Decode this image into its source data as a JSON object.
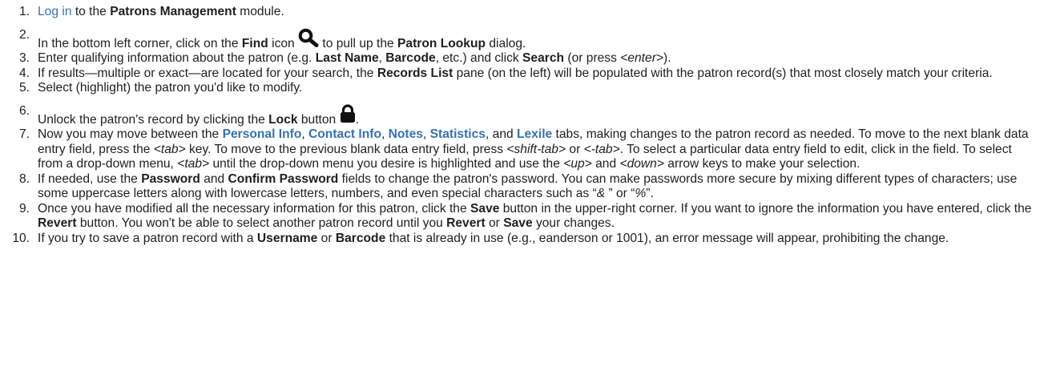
{
  "steps": [
    {
      "num": "1.",
      "a": "Log in",
      "b": " to the ",
      "c": "Patrons Management",
      "d": " module."
    },
    {
      "num": "2.",
      "a": "In the bottom left corner, click on the ",
      "b": "Find",
      "c": " icon ",
      "d": " to pull up the ",
      "e": "Patron Lookup",
      "f": " dialog.",
      "icon": "search-icon"
    },
    {
      "num": "3.",
      "a": "Enter qualifying information about the patron (e.g. ",
      "b": "Last Name",
      "c": ", ",
      "d": "Barcode",
      "e": ", etc.) and click ",
      "f": "Search",
      "g": " (or press ",
      "h": "<enter>",
      "i": ")."
    },
    {
      "num": "4.",
      "a": "If results—multiple or exact—are located for your search, the ",
      "b": "Records List",
      "c": " pane (on the left) will be populated with the patron record(s) that most closely match your criteria."
    },
    {
      "num": "5.",
      "a": "Select (highlight) the patron you'd like to modify."
    },
    {
      "num": "6.",
      "a": "Unlock the patron's record by clicking the ",
      "b": "Lock",
      "c": " button ",
      "d": ".",
      "icon": "lock-icon"
    },
    {
      "num": "7.",
      "a": "Now you may move between the ",
      "b": "Personal Info",
      "c": ", ",
      "d": "Contact Info",
      "e": ", ",
      "f": "Notes",
      "g": ", ",
      "h": "Statistics",
      "i": ", and ",
      "j": "Lexile",
      "k": " tabs, making changes to the patron record as needed. To move to the next blank data entry field, press the ",
      "l": "<tab>",
      "m": " key. To move to the previous blank data entry field, press ",
      "n": "<shift-tab>",
      "o": " or ",
      "p": "<-tab>",
      "q": ". To select a particular data entry field to edit, click in the field. To select from a drop-down menu, ",
      "r": "<tab>",
      "s": " until the drop-down menu you desire is highlighted and use the ",
      "t": "<up>",
      "u": " and ",
      "v": "<down>",
      "w": " arrow keys to make your selection."
    },
    {
      "num": "8.",
      "a": "If needed, use the ",
      "b": "Password",
      "c": " and ",
      "d": "Confirm Password",
      "e": " fields to change the patron's password. You can make passwords more secure by mixing different types of characters; use some uppercase letters along with lowercase letters, numbers, and even special characters such as “",
      "f": "&",
      "g": " ” or “",
      "h": "%",
      "i": "”."
    },
    {
      "num": "9.",
      "a": "Once you have modified all the necessary information for this patron, click the ",
      "b": "Save",
      "c": " button in the upper-right corner. If you want to ignore the information you have entered, click the ",
      "d": "Revert",
      "e": " button. You won't be able to select another patron record until you ",
      "f": "Revert",
      "g": " or ",
      "h": "Save",
      "i": " your changes."
    },
    {
      "num": "10.",
      "a": "If you try to save a patron record with a ",
      "b": "Username",
      "c": " or ",
      "d": "Barcode",
      "e": " that is already in use (e.g., eanderson or 1001), an error message will appear, prohibiting the change."
    }
  ]
}
